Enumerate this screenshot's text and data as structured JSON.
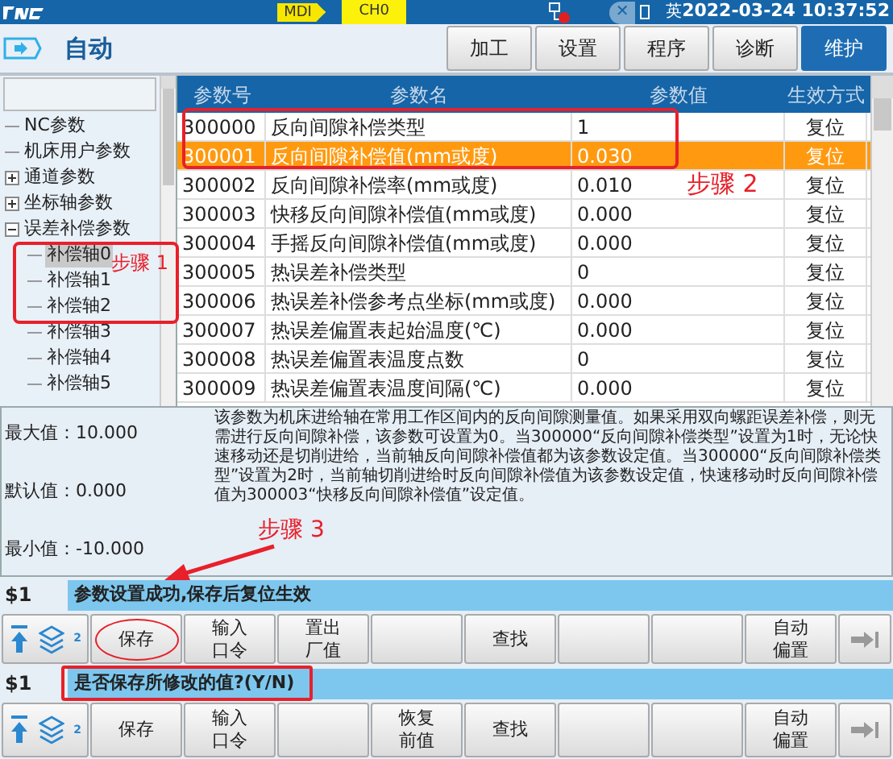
{
  "top_bar": {
    "mode": "MDI",
    "channel": "CH0",
    "lang_icon": "✕",
    "language": "英",
    "datetime": "2022-03-24 10:37:52"
  },
  "header": {
    "title": "自动",
    "tabs": [
      {
        "label": "加工",
        "selected": false
      },
      {
        "label": "设置",
        "selected": false
      },
      {
        "label": "程序",
        "selected": false
      },
      {
        "label": "诊断",
        "selected": false
      },
      {
        "label": "维护",
        "selected": true
      }
    ]
  },
  "tree": [
    {
      "label": "NC参数",
      "selected": false
    },
    {
      "label": "机床用户参数",
      "selected": false
    },
    {
      "label": "通道参数",
      "selected": false,
      "expanded": false
    },
    {
      "label": "坐标轴参数",
      "selected": false,
      "expanded": false
    },
    {
      "label": "误差补偿参数",
      "selected": false,
      "expanded": true,
      "children": [
        {
          "label": "补偿轴0",
          "selected": true
        },
        {
          "label": "补偿轴1",
          "selected": false
        },
        {
          "label": "补偿轴2",
          "selected": false
        },
        {
          "label": "补偿轴3",
          "selected": false
        },
        {
          "label": "补偿轴4",
          "selected": false
        },
        {
          "label": "补偿轴5",
          "selected": false
        }
      ]
    }
  ],
  "table": {
    "columns": [
      "参数号",
      "参数名",
      "参数值",
      "生效方式"
    ],
    "rows": [
      {
        "cells": [
          "300000",
          "反向间隙补偿类型",
          "1",
          "复位"
        ],
        "selected": false
      },
      {
        "cells": [
          "300001",
          "反向间隙补偿值(mm或度)",
          "0.030",
          "复位"
        ],
        "selected": true
      },
      {
        "cells": [
          "300002",
          "反向间隙补偿率(mm或度)",
          "0.010",
          "复位"
        ],
        "selected": false
      },
      {
        "cells": [
          "300003",
          "快移反向间隙补偿值(mm或度)",
          "0.000",
          "复位"
        ],
        "selected": false
      },
      {
        "cells": [
          "300004",
          "手摇反向间隙补偿值(mm或度)",
          "0.000",
          "复位"
        ],
        "selected": false
      },
      {
        "cells": [
          "300005",
          "热误差补偿类型",
          "0",
          "复位"
        ],
        "selected": false
      },
      {
        "cells": [
          "300006",
          "热误差补偿参考点坐标(mm或度)",
          "0.000",
          "复位"
        ],
        "selected": false
      },
      {
        "cells": [
          "300007",
          "热误差偏置表起始温度(℃)",
          "0.000",
          "复位"
        ],
        "selected": false
      },
      {
        "cells": [
          "300008",
          "热误差偏置表温度点数",
          "0",
          "复位"
        ],
        "selected": false
      },
      {
        "cells": [
          "300009",
          "热误差偏置表温度间隔(℃)",
          "0.000",
          "复位"
        ],
        "selected": false
      }
    ]
  },
  "details": {
    "limits": [
      "最大值：10.000",
      "默认值：0.000",
      "最小值：-10.000"
    ],
    "description": "该参数为机床进给轴在常用工作区间内的反向间隙测量值。如果采用双向螺距误差补偿，则无需进行反向间隙补偿，该参数可设置为0。当300000“反向间隙补偿类型”设置为1时，无论快速移动还是切削进给，当前轴反向间隙补偿值都为该参数设定值。当300000“反向间隙补偿类型”设置为2时，当前轴切削进给时反向间隙补偿值为该参数设定值，快速移动时反向间隙补偿值为300003“快移反向间隙补偿值”设定值。"
  },
  "panels": [
    {
      "channel": "$1",
      "message": "参数设置成功,保存后复位生效",
      "layer_badge": "2",
      "buttons": [
        {
          "kind": "text",
          "label": "保存"
        },
        {
          "kind": "text",
          "label": "输入口令"
        },
        {
          "kind": "text",
          "label": "置出厂值"
        },
        {
          "kind": "empty"
        },
        {
          "kind": "text",
          "label": "查找"
        },
        {
          "kind": "empty"
        },
        {
          "kind": "empty"
        },
        {
          "kind": "text",
          "label": "自动偏置"
        }
      ]
    },
    {
      "channel": "$1",
      "message": "是否保存所修改的值?(Y/N)",
      "layer_badge": "2",
      "buttons": [
        {
          "kind": "text",
          "label": "保存"
        },
        {
          "kind": "text",
          "label": "输入口令"
        },
        {
          "kind": "empty"
        },
        {
          "kind": "text",
          "label": "恢复前值"
        },
        {
          "kind": "text",
          "label": "查找"
        },
        {
          "kind": "empty"
        },
        {
          "kind": "empty"
        },
        {
          "kind": "text",
          "label": "自动偏置"
        }
      ]
    }
  ],
  "annotations": [
    {
      "label": "步骤 1"
    },
    {
      "label": "步骤 2"
    },
    {
      "label": "步骤 3"
    }
  ]
}
